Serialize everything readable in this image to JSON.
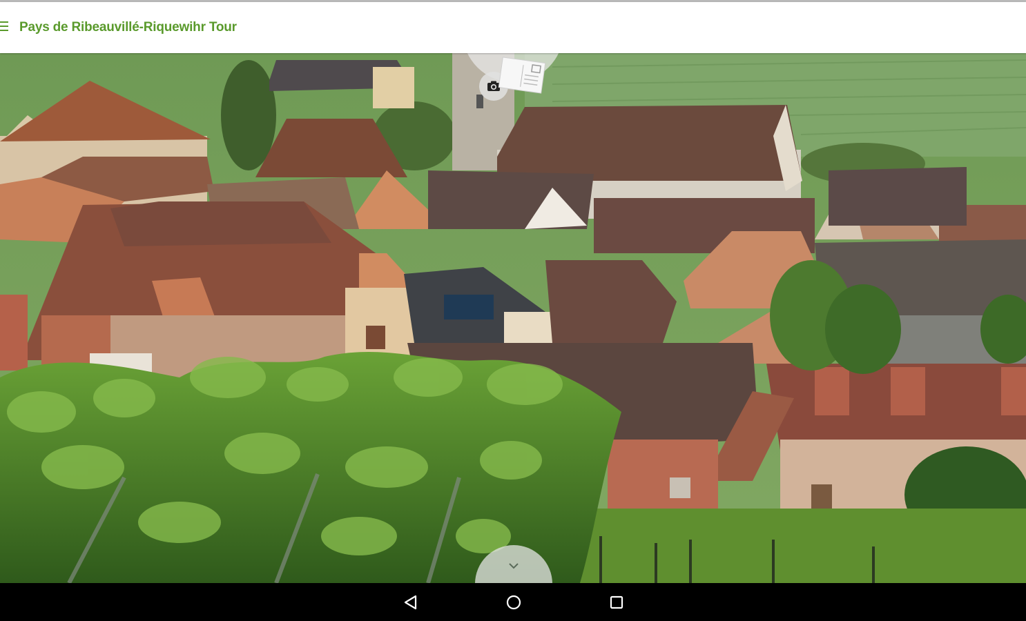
{
  "app_bar": {
    "title": "Pays de Ribeauvillé-Riquewihr Tour",
    "menu_icon": "hamburger-menu-icon",
    "accent_color": "#5a9a2c"
  },
  "overlay": {
    "camera_icon": "camera-icon",
    "postcard_icon": "postcard-icon",
    "expand_icon": "chevron-down-icon"
  },
  "photo": {
    "subject": "village-rooftops-vineyard"
  },
  "nav_bar": {
    "back_icon": "back-triangle-icon",
    "home_icon": "home-circle-icon",
    "recents_icon": "recents-square-icon"
  }
}
